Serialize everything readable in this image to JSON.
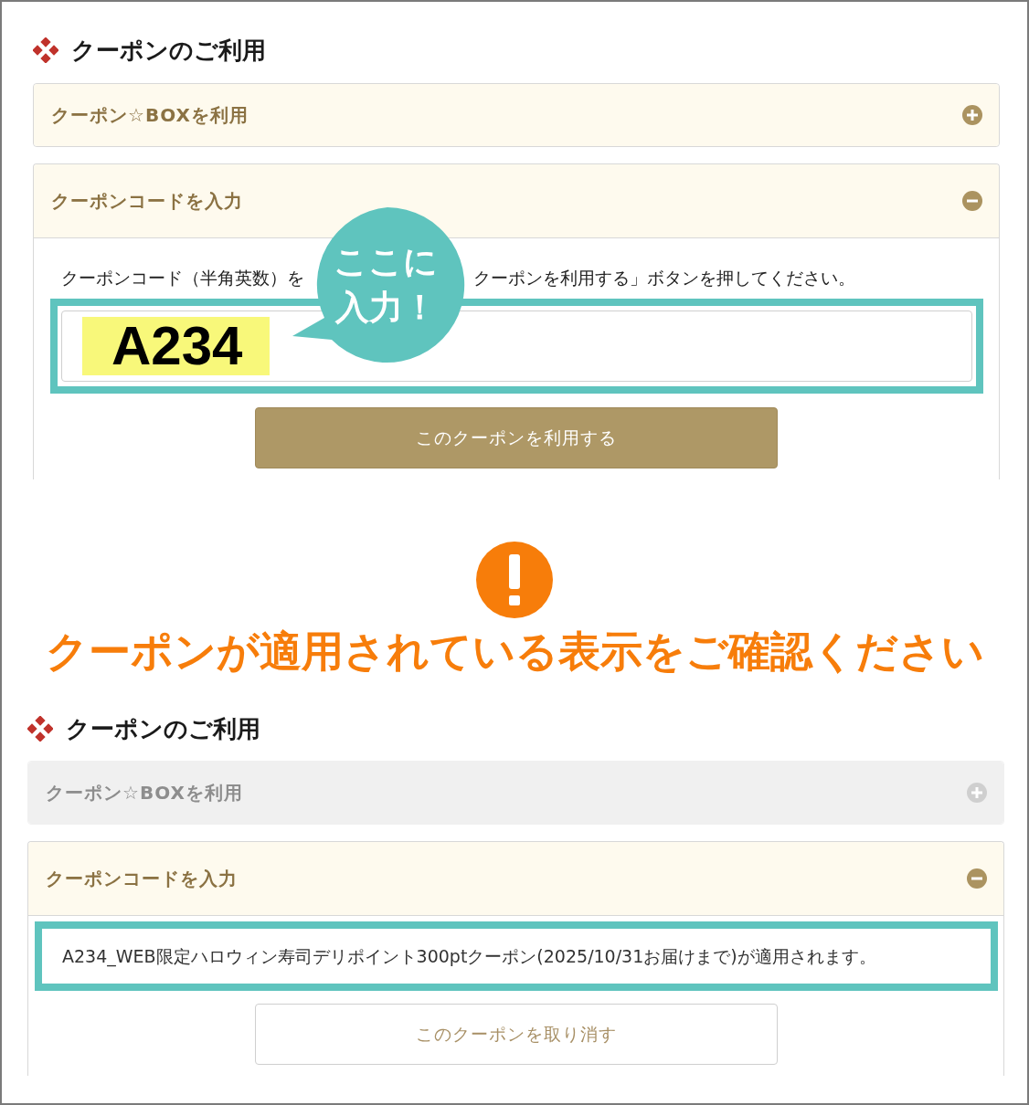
{
  "step1": {
    "heading": "クーポンのご利用",
    "accordions": [
      {
        "title": "クーポン☆BOXを利用",
        "expanded": false,
        "disabled": false
      },
      {
        "title": "クーポンコードを入力",
        "expanded": true,
        "disabled": false
      }
    ],
    "instruction_before": "クーポンコード（半角英数）を",
    "instruction_after": "クーポンを利用する」ボタンを押してください。",
    "code_field": {
      "value": "A234"
    },
    "callout": [
      "ここに",
      "入力！"
    ],
    "apply_button": "このクーポンを利用する"
  },
  "notice": {
    "message": "クーポンが適用されている表示をご確認ください"
  },
  "step2": {
    "heading": "クーポンのご利用",
    "accordions": [
      {
        "title": "クーポン☆BOXを利用",
        "expanded": false,
        "disabled": true
      },
      {
        "title": "クーポンコードを入力",
        "expanded": true,
        "disabled": false
      }
    ],
    "applied_message": "A234_WEB限定ハロウィン寿司デリポイント300ptクーポン(2025/10/31お届けまで)が適用されます。",
    "cancel_button": "このクーポンを取り消す"
  }
}
